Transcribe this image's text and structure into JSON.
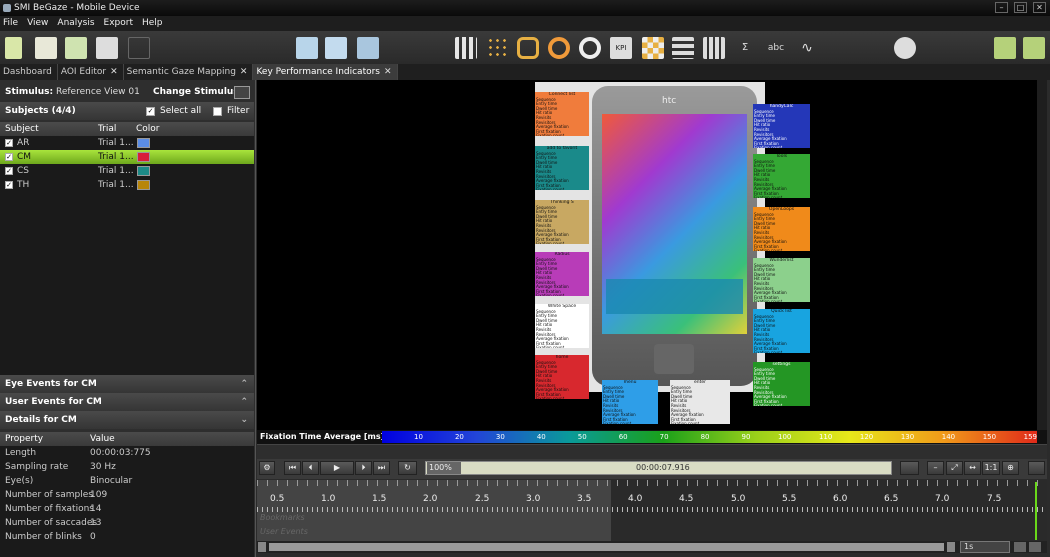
{
  "window": {
    "title": "SMI BeGaze - Mobile Device"
  },
  "menu": [
    "File",
    "View",
    "Analysis",
    "Export",
    "Help"
  ],
  "tabs": [
    {
      "label": "Dashboard"
    },
    {
      "label": "AOI Editor"
    },
    {
      "label": "Semantic Gaze Mapping"
    },
    {
      "label": "Key Performance Indicators"
    }
  ],
  "stimulus": {
    "label": "Stimulus:",
    "value": "Reference View 01",
    "change_label": "Change Stimulus:"
  },
  "subjects": {
    "title": "Subjects (4/4)",
    "select_all": "Select all",
    "filter": "Filter",
    "columns": [
      "Subject",
      "Trial",
      "Color"
    ],
    "rows": [
      {
        "subject": "AR",
        "trial": "Trial 1...",
        "color": "#5b8de6"
      },
      {
        "subject": "CM",
        "trial": "Trial 1...",
        "color": "#d81e3a"
      },
      {
        "subject": "CS",
        "trial": "Trial 1...",
        "color": "#1d8a87"
      },
      {
        "subject": "TH",
        "trial": "Trial 1...",
        "color": "#b8860b"
      }
    ]
  },
  "sections": {
    "eye_events": "Eye Events for CM",
    "user_events": "User Events for CM",
    "details": "Details for CM"
  },
  "details": {
    "columns": [
      "Property",
      "Value"
    ],
    "rows": [
      {
        "p": "Length",
        "v": "00:00:03:775"
      },
      {
        "p": "Sampling rate",
        "v": "30 Hz"
      },
      {
        "p": "Eye(s)",
        "v": "Binocular"
      },
      {
        "p": "Number of samples",
        "v": "109"
      },
      {
        "p": "Number of fixations",
        "v": "14"
      },
      {
        "p": "Number of saccades",
        "v": "13"
      },
      {
        "p": "Number of blinks",
        "v": "0"
      }
    ]
  },
  "phone": {
    "brand": "htc"
  },
  "kpi_boxes": [
    {
      "title": "Connect list",
      "color": "#f07c3c"
    },
    {
      "title": "add to favorit",
      "color": "#1a8a8a"
    },
    {
      "title": "Thinking S",
      "color": "#c8a862"
    },
    {
      "title": "Radius",
      "color": "#b83cb8"
    },
    {
      "title": "White Space",
      "color": "#ffffff"
    },
    {
      "title": "home",
      "color": "#d8282e"
    },
    {
      "title": "menu",
      "color": "#2e9ee8"
    },
    {
      "title": "enter",
      "color": "#e8e8e8"
    },
    {
      "title": "handyCalc",
      "color": "#2437b8"
    },
    {
      "title": "Tools",
      "color": "#34a834"
    },
    {
      "title": "OpenLoops",
      "color": "#f08a1a"
    },
    {
      "title": "Wunderlist",
      "color": "#8cd08c"
    },
    {
      "title": "Quick list",
      "color": "#18a4e0"
    },
    {
      "title": "settings",
      "color": "#249624"
    }
  ],
  "kpi_rows": [
    "Sequence",
    "Entry time",
    "Dwell time",
    "Hit ratio",
    "Revisits",
    "Revisitors",
    "Average fixation",
    "First fixation",
    "Fixation count"
  ],
  "fixation_bar": {
    "label": "Fixation Time Average [ms]",
    "ticks": [
      "10",
      "20",
      "30",
      "40",
      "50",
      "60",
      "70",
      "80",
      "90",
      "100",
      "110",
      "120",
      "130",
      "140",
      "150",
      "159"
    ]
  },
  "playback": {
    "zoom": "100%",
    "time": "00:00:07.916",
    "speed": "1s",
    "one_to_one": "1:1"
  },
  "timeline": {
    "ticks": [
      "0.5",
      "1.0",
      "1.5",
      "2.0",
      "2.5",
      "3.0",
      "3.5",
      "4.0",
      "4.5",
      "5.0",
      "5.5",
      "6.0",
      "6.5",
      "7.0",
      "7.5"
    ],
    "tracks": [
      "Bookmarks",
      "User Events"
    ]
  }
}
